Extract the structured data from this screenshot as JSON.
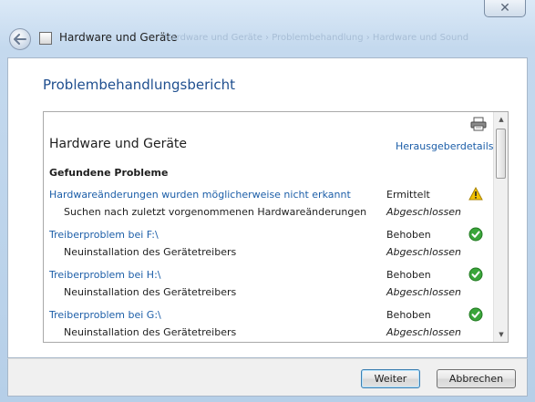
{
  "window": {
    "title": "Hardware und Geräte",
    "breadcrumb_ghost": "Hardware und Geräte › Problembehandlung › Hardware und Sound",
    "close_label": "✕"
  },
  "main": {
    "heading": "Problembehandlungsbericht"
  },
  "report": {
    "title": "Hardware und Geräte",
    "publisher_link": "Herausgeberdetails",
    "section_title": "Gefundene Probleme",
    "problems": [
      {
        "title": "Hardwareänderungen wurden möglicherweise nicht erkannt",
        "status": "Ermittelt",
        "subtitle": "Suchen nach zuletzt vorgenommenen Hardwareänderungen",
        "sub_status": "Abgeschlossen",
        "icon": "warning-icon"
      },
      {
        "title": "Treiberproblem bei F:\\",
        "status": "Behoben",
        "subtitle": "Neuinstallation des Gerätetreibers",
        "sub_status": "Abgeschlossen",
        "icon": "check-icon"
      },
      {
        "title": "Treiberproblem bei H:\\",
        "status": "Behoben",
        "subtitle": "Neuinstallation des Gerätetreibers",
        "sub_status": "Abgeschlossen",
        "icon": "check-icon"
      },
      {
        "title": "Treiberproblem bei G:\\",
        "status": "Behoben",
        "subtitle": "Neuinstallation des Gerätetreibers",
        "sub_status": "Abgeschlossen",
        "icon": "check-icon"
      }
    ]
  },
  "footer": {
    "next_label": "Weiter",
    "cancel_label": "Abbrechen"
  },
  "colors": {
    "link": "#1c5ea8",
    "heading": "#1f4f8f",
    "warning": "#f2c200",
    "success": "#3aa53a"
  }
}
